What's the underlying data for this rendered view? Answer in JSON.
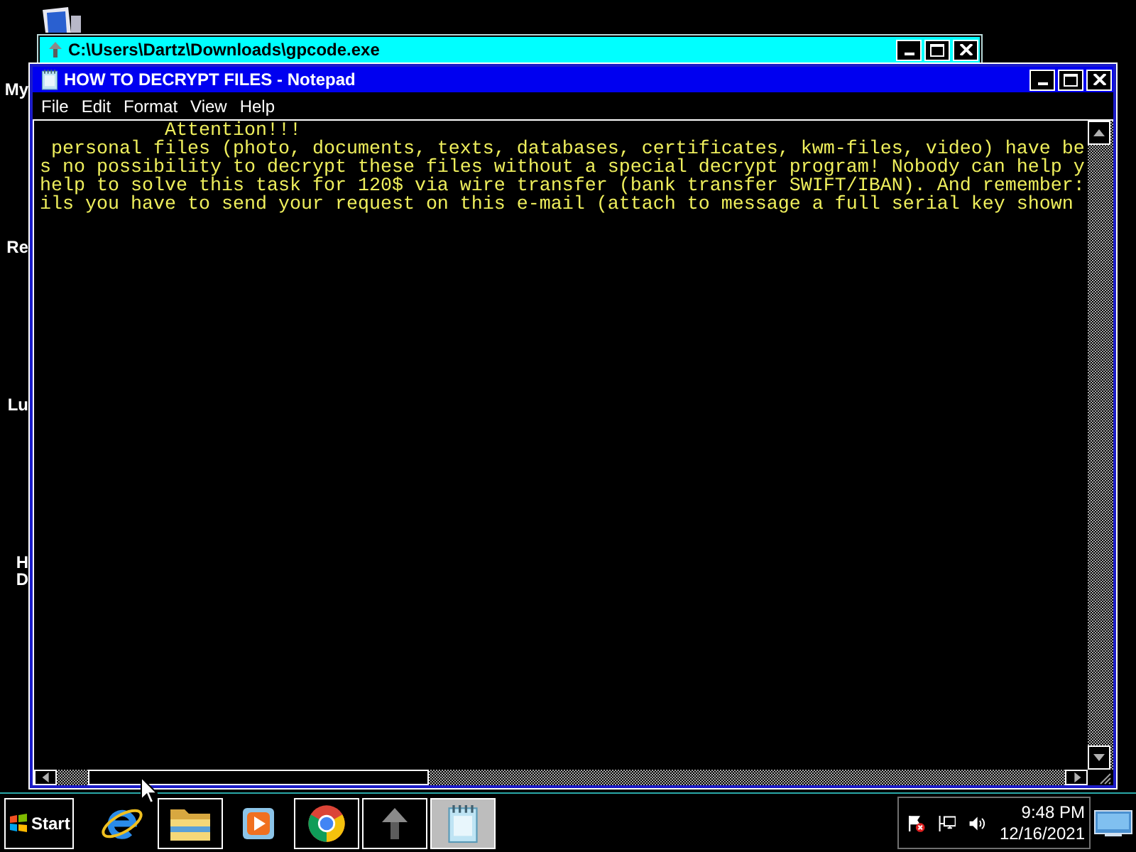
{
  "desktop_icons": [
    {
      "lines": [
        "My"
      ]
    },
    {
      "lines": [
        "Re"
      ]
    },
    {
      "lines": [
        "Lu"
      ]
    },
    {
      "lines": [
        "H",
        "D"
      ]
    }
  ],
  "background_window": {
    "title": "C:\\Users\\Dartz\\Downloads\\gpcode.exe",
    "active": false
  },
  "notepad": {
    "title": "HOW TO DECRYPT FILES - Notepad",
    "active": true,
    "menu": [
      "File",
      "Edit",
      "Format",
      "View",
      "Help"
    ],
    "lines": [
      {
        "kind": "heading",
        "text": "Attention!!!"
      },
      {
        "kind": "body",
        "text": " personal files (photo, documents, texts, databases, certificates, kwm-files, video) have be"
      },
      {
        "kind": "body",
        "text": "s no possibility to decrypt these files without a special decrypt program! Nobody can help y"
      },
      {
        "kind": "body",
        "text": "help to solve this task for 120$ via wire transfer (bank transfer SWIFT/IBAN). And remember:"
      },
      {
        "kind": "body",
        "text": "ils you have to send your request on this e-mail (attach to message a full serial key shown"
      }
    ]
  },
  "taskbar": {
    "start": "Start",
    "apps": [
      {
        "kind": "browser",
        "running": false,
        "selected": false
      },
      {
        "kind": "folder",
        "running": true,
        "selected": false
      },
      {
        "kind": "player",
        "running": false,
        "selected": false
      },
      {
        "kind": "wheel",
        "running": true,
        "selected": false
      },
      {
        "kind": "arrow",
        "running": true,
        "selected": false
      },
      {
        "kind": "notepad",
        "running": true,
        "selected": true
      }
    ],
    "tray": {
      "time": "9:48 PM",
      "date": "12/16/2021"
    }
  }
}
